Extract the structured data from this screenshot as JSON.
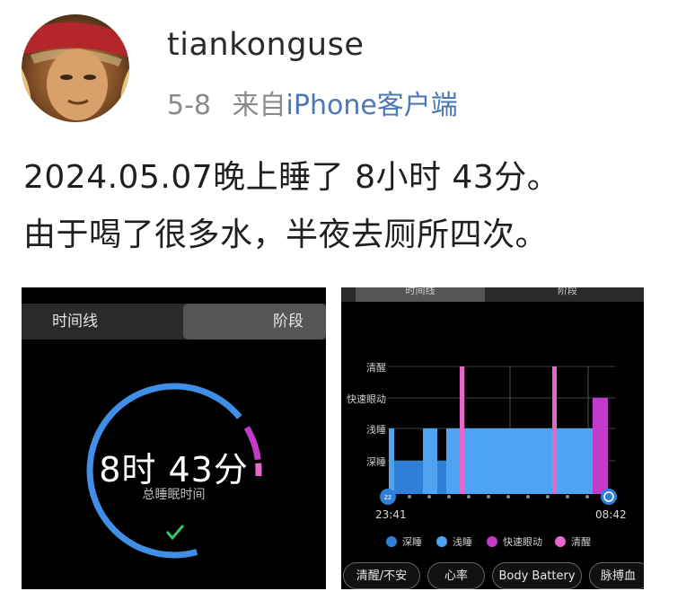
{
  "post": {
    "username": "tiankonguse",
    "date": "5-8",
    "from_label": "来自",
    "source": "iPhone客户端",
    "line1": "2024.05.07晚上睡了 8小时 43分。",
    "line2": "由于喝了很多水，半夜去厕所四次。"
  },
  "screenshot1": {
    "tabs": [
      "时间线",
      "阶段"
    ],
    "total_time": "8时 43分",
    "total_label": "总睡眠时间",
    "check_icon": "check-icon"
  },
  "screenshot2": {
    "tabs": [
      "时间线",
      "阶段"
    ],
    "y_labels": [
      "清醒",
      "快速眼动",
      "浅睡",
      "深睡"
    ],
    "start_time": "23:41",
    "end_time": "08:42",
    "legend": [
      {
        "label": "深睡",
        "color": "#2f7fd8"
      },
      {
        "label": "浅睡",
        "color": "#4ea3f2"
      },
      {
        "label": "快速眼动",
        "color": "#c23bc8"
      },
      {
        "label": "清醒",
        "color": "#e567c9"
      }
    ],
    "chips": [
      "清醒/不安",
      "心率",
      "Body Battery",
      "脉搏血"
    ]
  }
}
